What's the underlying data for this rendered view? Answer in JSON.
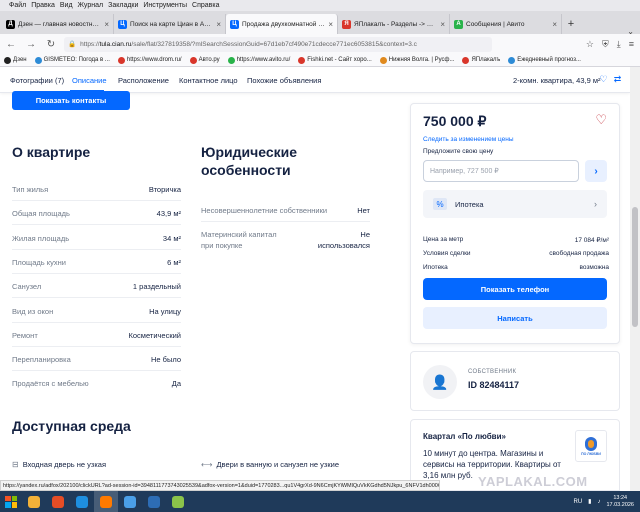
{
  "browser": {
    "menu": [
      "Файл",
      "Правка",
      "Вид",
      "Журнал",
      "Закладки",
      "Инструменты",
      "Справка"
    ],
    "tabs": [
      {
        "title": "Дзен — главная новостная и",
        "color": "#000000",
        "glyph": "Д",
        "active": false
      },
      {
        "title": "Поиск на карте Циан в Астра",
        "color": "#0468ff",
        "glyph": "Ц",
        "active": false
      },
      {
        "title": "Продажа двухкомнатной квар",
        "color": "#0468ff",
        "glyph": "Ц",
        "active": true
      },
      {
        "title": "ЯПлакалъ - Разделы -> Цену",
        "color": "#d9362b",
        "glyph": "Я",
        "active": false
      },
      {
        "title": "Сообщения | Авито",
        "color": "#29b34a",
        "glyph": "А",
        "active": false
      }
    ],
    "url_prefix": "https://",
    "url_domain": "tula.cian.ru",
    "url_rest": "/sale/flat/327819358/?mlSearchSessionGuid=67d1eb7cf490e71cdecce771ec6053815&context=3.c",
    "bookmarks": [
      {
        "label": "Дзен",
        "color": "#222222"
      },
      {
        "label": "GISMETEO: Погода в ...",
        "color": "#2d8bd6"
      },
      {
        "label": "https://www.drom.ru/",
        "color": "#d9362b"
      },
      {
        "label": "Авто.ру",
        "color": "#d9362b"
      },
      {
        "label": "https://www.avito.ru/",
        "color": "#29b34a"
      },
      {
        "label": "Fishki.net - Сайт хоро...",
        "color": "#d9362b"
      },
      {
        "label": "Нижняя Волга. | Русф...",
        "color": "#e08a1e"
      },
      {
        "label": "ЯПлакалъ",
        "color": "#d9362b"
      },
      {
        "label": "Ежедневный прогноз...",
        "color": "#2d8bd6"
      }
    ]
  },
  "subnav": {
    "links": [
      "Фотографии (7)",
      "Описание",
      "Расположение",
      "Контактное лицо",
      "Похожие объявления"
    ],
    "active_index": 1,
    "listing_title": "2-комн. квартира, 43,9 м²"
  },
  "contacts_button": "Показать контакты",
  "about": {
    "title": "О квартире",
    "rows": [
      {
        "k": "Тип жилья",
        "v": "Вторичка"
      },
      {
        "k": "Общая площадь",
        "v": "43,9 м²"
      },
      {
        "k": "Жилая площадь",
        "v": "34 м²"
      },
      {
        "k": "Площадь кухни",
        "v": "6 м²"
      },
      {
        "k": "Санузел",
        "v": "1 раздельный"
      },
      {
        "k": "Вид из окон",
        "v": "На улицу"
      },
      {
        "k": "Ремонт",
        "v": "Косметический"
      },
      {
        "k": "Перепланировка",
        "v": "Не было"
      },
      {
        "k": "Продаётся с мебелью",
        "v": "Да"
      }
    ]
  },
  "legal": {
    "title_line1": "Юридические",
    "title_line2": "особенности",
    "rows": [
      {
        "k": "Несовершеннолетние собственники",
        "v": "Нет"
      },
      {
        "k1": "Материнский капитал",
        "k2": "при покупке",
        "v1": "Не",
        "v2": "использовался"
      }
    ]
  },
  "accessibility": {
    "title": "Доступная среда",
    "items": [
      "Входная дверь не узкая",
      "Двери в ванную и санузел не узкие"
    ]
  },
  "sidebar": {
    "price": "750 000 ₽",
    "follow": "Следить за изменением цены",
    "offer_label": "Предложите свою цену",
    "offer_placeholder": "Например, 727 500 ₽",
    "mortgage": "Ипотека",
    "stats": [
      {
        "k": "Цена за метр",
        "v": "17 084 ₽/м²"
      },
      {
        "k": "Условия сделки",
        "v": "свободная продажа"
      },
      {
        "k": "Ипотека",
        "v": "возможна"
      }
    ],
    "phone_button": "Показать телефон",
    "write_button": "Написать"
  },
  "owner": {
    "role": "СОБСТВЕННИК",
    "id": "ID 82484117"
  },
  "promo": {
    "title": "Квартал «По любви»",
    "text": "10 минут до центра. Магазины и сервисы на территории. Квартиры от 3,16 млн руб.",
    "logo_text": "ПО ЛЮБВИ"
  },
  "status_url": "https://yandex.ru/adfox/202100/clickURL?ad-session-id=3948111773743025539&adfox-version=1&duid=1770283...qu1V4grXd-9N6CmjKYiWMlQuVkKGdhd5NJkpu_6NFV1dh000Oj_ceryw_Sbdtv-tbu1tn...EaaFoVSZ/-/Fcb1bDVJ6hwq1fsdvk4kdm9J925",
  "watermark": "YAPLAKAL.COM",
  "taskbar": {
    "lang": "RU",
    "time": "13:24",
    "date": "17.03.2026",
    "apps": [
      "#f2b138",
      "#e54d26",
      "#1e8fe0",
      "#ff7a00",
      "#4a9fe8",
      "#2d6db5",
      "#8bc34a"
    ]
  }
}
